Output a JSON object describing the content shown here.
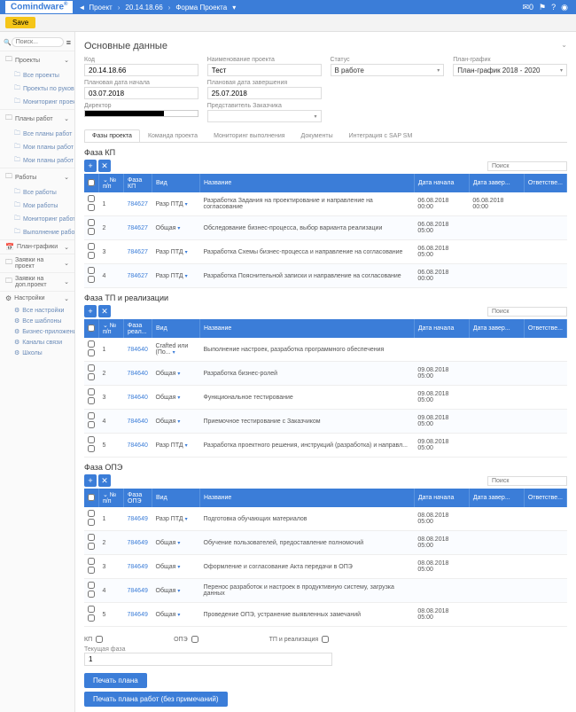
{
  "top": {
    "logo": "Comindware",
    "crumb1": "Проект",
    "crumb2": "20.14.18.66",
    "crumb3": "Форма Проекта",
    "mail_badge": "0"
  },
  "save": "Save",
  "search_ph": "Поиск...",
  "sidebar": {
    "g1": "Проекты",
    "g1_items": [
      "Все проекты",
      "Проекты по руководит...",
      "Мониторинг проектов"
    ],
    "g2": "Планы работ",
    "g2_items": [
      "Все планы работ",
      "Мои планы работ (Ку...",
      "Мои планы работ (Ру..."
    ],
    "g3": "Работы",
    "g3_items": [
      "Все работы",
      "Мои работы",
      "Мониторинг работ",
      "Выполнение работ п..."
    ],
    "g4": "План-графики",
    "g5": "Заявки на проект",
    "g6": "Заявки на доп.проект",
    "g7": "Настройки",
    "g7_items": [
      "Все настройки",
      "Все шаблоны",
      "Бизнес-приложения",
      "Каналы связи",
      "Школы"
    ]
  },
  "section": "Основные данные",
  "form": {
    "code_l": "Код",
    "code_v": "20.14.18.66",
    "name_l": "Наименование проекта",
    "name_v": "Тест",
    "status_l": "Статус",
    "status_v": "В работе",
    "plan_l": "План-график",
    "plan_v": "План-график 2018 - 2020",
    "pstart_l": "Плановая дата начала",
    "pstart_v": "03.07.2018",
    "pend_l": "Плановая дата завершения",
    "pend_v": "25.07.2018",
    "dir_l": "Директор",
    "rep_l": "Представитель Заказчика"
  },
  "tabs": [
    "Фазы проекта",
    "Команда проекта",
    "Мониторинг выполнения",
    "Документы",
    "Интеграция с SAP SM"
  ],
  "search_tbl": "Поиск",
  "phase1": {
    "title": "Фаза КП",
    "cols": {
      "num": "№ п/п",
      "id": "Фаза КП",
      "vid": "Вид",
      "name": "Название",
      "ds": "Дата начала",
      "de": "Дата завер...",
      "resp": "Ответстве..."
    },
    "rows": [
      {
        "n": "1",
        "id": "784627",
        "vid": "Разр ПТД",
        "name": "Разработка Задания на проектирование и направление на согласование",
        "ds": "06.08.2018 00:00",
        "de": "06.08.2018 00:00"
      },
      {
        "n": "2",
        "id": "784627",
        "vid": "Общая",
        "name": "Обследование бизнес-процесса, выбор варианта реализации",
        "ds": "06.08.2018 05:00",
        "de": ""
      },
      {
        "n": "3",
        "id": "784627",
        "vid": "Разр ПТД",
        "name": "Разработка Схемы бизнес-процесса и направление на согласование",
        "ds": "06.08.2018 05:00",
        "de": ""
      },
      {
        "n": "4",
        "id": "784627",
        "vid": "Разр ПТД",
        "name": "Разработка Пояснительной записки и направление на согласование",
        "ds": "06.08.2018 00:00",
        "de": ""
      }
    ]
  },
  "phase2": {
    "title": "Фаза ТП и реализации",
    "cols": {
      "num": "№ п/п",
      "id": "Фаза реал...",
      "vid": "Вид",
      "name": "Название",
      "ds": "Дата начала",
      "de": "Дата завер...",
      "resp": "Ответстве..."
    },
    "rows": [
      {
        "n": "1",
        "id": "784640",
        "vid": "Crafted или (По...",
        "name": "Выполнение настроек, разработка программного обеспечения",
        "ds": "",
        "de": ""
      },
      {
        "n": "2",
        "id": "784640",
        "vid": "Общая",
        "name": "Разработка бизнес-ролей",
        "ds": "09.08.2018 05:00",
        "de": ""
      },
      {
        "n": "3",
        "id": "784640",
        "vid": "Общая",
        "name": "Функциональное тестирование",
        "ds": "09.08.2018 05:00",
        "de": ""
      },
      {
        "n": "4",
        "id": "784640",
        "vid": "Общая",
        "name": "Приемочное тестирование с Заказчиком",
        "ds": "09.08.2018 05:00",
        "de": ""
      },
      {
        "n": "5",
        "id": "784640",
        "vid": "Разр ПТД",
        "name": "Разработка проектного решения, инструкций (разработка) и направл...",
        "ds": "09.08.2018 05:00",
        "de": ""
      }
    ]
  },
  "phase3": {
    "title": "Фаза ОПЭ",
    "cols": {
      "num": "№ п/п",
      "id": "Фаза ОПЭ",
      "vid": "Вид",
      "name": "Название",
      "ds": "Дата начала",
      "de": "Дата завер...",
      "resp": "Ответстве..."
    },
    "rows": [
      {
        "n": "1",
        "id": "784649",
        "vid": "Разр ПТД",
        "name": "Подготовка обучающих материалов",
        "ds": "08.08.2018 05:00",
        "de": ""
      },
      {
        "n": "2",
        "id": "784649",
        "vid": "Общая",
        "name": "Обучение пользователей, предоставление полномочий",
        "ds": "08.08.2018 05:00",
        "de": ""
      },
      {
        "n": "3",
        "id": "784649",
        "vid": "Общая",
        "name": "Оформление и согласование Акта передачи в ОПЭ",
        "ds": "08.08.2018 05:00",
        "de": ""
      },
      {
        "n": "4",
        "id": "784649",
        "vid": "Общая",
        "name": "Перенос разработок и настроек в продуктивную систему, загрузка данных",
        "ds": "",
        "de": ""
      },
      {
        "n": "5",
        "id": "784649",
        "vid": "Общая",
        "name": "Проведение ОПЭ, устранение выявленных замечаний",
        "ds": "08.08.2018 05:00",
        "de": ""
      }
    ]
  },
  "status": {
    "s1": "КП",
    "s2": "ОПЭ",
    "s3": "ТП и реализация"
  },
  "cur_phase": {
    "label": "Текущая фаза",
    "value": "1"
  },
  "btn1": "Печать плана",
  "btn2": "Печать плана работ (без примечаний)"
}
